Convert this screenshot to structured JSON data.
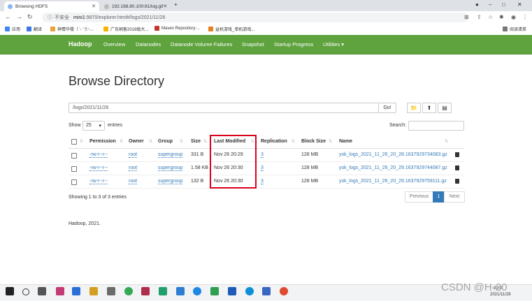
{
  "browser": {
    "tabs": [
      {
        "title": "Browsing HDFS"
      },
      {
        "title": "192.168.80.100:81/log.gif"
      }
    ],
    "new_tab": "+",
    "window": {
      "minimize": "–",
      "maximize": "□",
      "close": "✕"
    },
    "address": {
      "insecure_label": "不安全",
      "host": "mini1",
      "path": ":9870/explorer.html#/logs/2021/11/26"
    },
    "bookmarks": [
      {
        "label": "应用",
        "color": "#4285f4"
      },
      {
        "label": "翻译",
        "color": "#3b78e7"
      },
      {
        "label": "神情华楼（ '- 'う'-...",
        "color": "#e8a33d"
      },
      {
        "label": "广东刷客2019级大...",
        "color": "#f4b400"
      },
      {
        "label": "Maven Repository:...",
        "color": "#c0392b"
      },
      {
        "label": "益机游戏_单机游戏...",
        "color": "#e67e22"
      }
    ],
    "reading_list": "阅读清单"
  },
  "navbar": {
    "brand": "Hadoop",
    "links": [
      "Overview",
      "Datanodes",
      "Datanode Volume Failures",
      "Snapshot",
      "Startup Progress",
      "Utilities ▾"
    ]
  },
  "page": {
    "title": "Browse Directory",
    "path_value": "/logs/2021/11/26",
    "go_label": "Go!",
    "show_label": "Show",
    "entries_value": "25",
    "entries_label": "entries",
    "search_label": "Search:",
    "columns": [
      "Permission",
      "Owner",
      "Group",
      "Size",
      "Last Modified",
      "Replication",
      "Block Size",
      "Name"
    ],
    "rows": [
      {
        "permission": "-rw-r--r--",
        "owner": "root",
        "group": "supergroup",
        "size": "331 B",
        "modified": "Nov 26 20:29",
        "replication": "3",
        "block_size": "128 MB",
        "name": "ysk_logs_2021_11_26_20_28.1637929734083.gz"
      },
      {
        "permission": "-rw-r--r--",
        "owner": "root",
        "group": "supergroup",
        "size": "1.58 KB",
        "modified": "Nov 26 20:30",
        "replication": "3",
        "block_size": "128 MB",
        "name": "ysk_logs_2021_11_26_20_29.1637929744087.gz"
      },
      {
        "permission": "-rw-r--r--",
        "owner": "root",
        "group": "supergroup",
        "size": "132 B",
        "modified": "Nov 26 20:30",
        "replication": "3",
        "block_size": "128 MB",
        "name": "ysk_logs_2021_11_26_20_29.1637929759111.gz"
      }
    ],
    "showing": "Showing 1 to 3 of 3 entries",
    "pagination": {
      "previous": "Previous",
      "current": "1",
      "next": "Next"
    },
    "footer": "Hadoop, 2021."
  },
  "taskbar": {
    "time": "20:3",
    "date": "2021/11/28",
    "watermark": "CSDN @H-20"
  },
  "colors": {
    "navbar": "#5fa33e",
    "highlight": "#d9001b",
    "link": "#337ab7"
  }
}
